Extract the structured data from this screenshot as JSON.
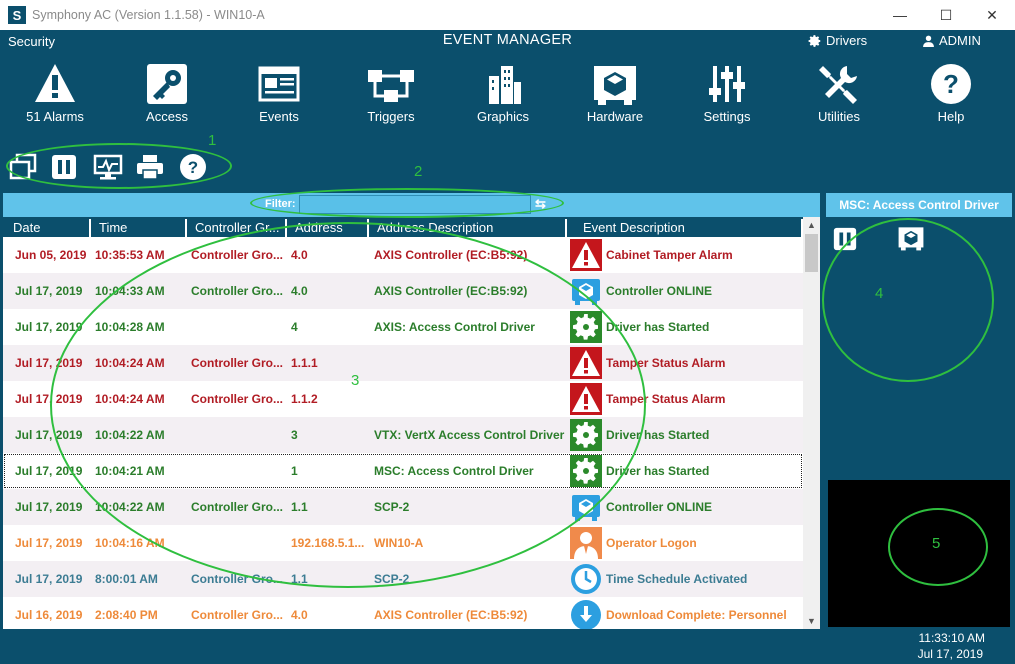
{
  "window": {
    "title": "Symphony AC  (Version 1.1.58) - WIN10-A",
    "logo_letter": "S",
    "minimize": "—",
    "maximize": "☐",
    "close": "✕"
  },
  "menubar": {
    "security": "Security",
    "title": "EVENT MANAGER",
    "drivers": "Drivers",
    "user": "ADMIN"
  },
  "toolbar": {
    "items": [
      {
        "label": "51 Alarms",
        "icon": "alarm-icon"
      },
      {
        "label": "Access",
        "icon": "access-icon"
      },
      {
        "label": "Events",
        "icon": "events-icon"
      },
      {
        "label": "Triggers",
        "icon": "triggers-icon"
      },
      {
        "label": "Graphics",
        "icon": "graphics-icon"
      },
      {
        "label": "Hardware",
        "icon": "hardware-icon"
      },
      {
        "label": "Settings",
        "icon": "settings-icon"
      },
      {
        "label": "Utilities",
        "icon": "utilities-icon"
      },
      {
        "label": "Help",
        "icon": "help-icon"
      }
    ]
  },
  "annotations": {
    "a1": "1",
    "a2": "2",
    "a3": "3",
    "a4": "4",
    "a5": "5"
  },
  "filter": {
    "label": "Filter:",
    "value": "",
    "go": "⇆"
  },
  "table": {
    "columns": [
      "Date",
      "Time",
      "Controller Gr...",
      "Address",
      "Address Description",
      "Event Description"
    ],
    "rows": [
      {
        "date": "Jun 05, 2019",
        "time": "10:35:53 AM",
        "group": "Controller Gro...",
        "address": "4.0",
        "addr_desc": "AXIS Controller (EC:B5:92)",
        "event": "Cabinet Tamper Alarm",
        "icon": "alarm-icon",
        "color": "#b11c24"
      },
      {
        "date": "Jul 17, 2019",
        "time": "10:04:33 AM",
        "group": "Controller Gro...",
        "address": "4.0",
        "addr_desc": "AXIS Controller (EC:B5:92)",
        "event": "Controller ONLINE",
        "icon": "hardware-icon",
        "color": "#2b7d2b"
      },
      {
        "date": "Jul 17, 2019",
        "time": "10:04:28 AM",
        "group": "",
        "address": "4",
        "addr_desc": "AXIS: Access Control Driver",
        "event": "Driver has Started",
        "icon": "gear-icon",
        "color": "#2b7d2b"
      },
      {
        "date": "Jul 17, 2019",
        "time": "10:04:24 AM",
        "group": "Controller Gro...",
        "address": "1.1.1",
        "addr_desc": "",
        "event": "Tamper Status Alarm",
        "icon": "alarm-icon",
        "color": "#b11c24"
      },
      {
        "date": "Jul 17, 2019",
        "time": "10:04:24 AM",
        "group": "Controller Gro...",
        "address": "1.1.2",
        "addr_desc": "",
        "event": "Tamper Status Alarm",
        "icon": "alarm-icon",
        "color": "#b11c24"
      },
      {
        "date": "Jul 17, 2019",
        "time": "10:04:22 AM",
        "group": "",
        "address": "3",
        "addr_desc": "VTX: VertX Access Control Driver",
        "event": "Driver has Started",
        "icon": "gear-icon",
        "color": "#2b7d2b"
      },
      {
        "date": "Jul 17, 2019",
        "time": "10:04:21 AM",
        "group": "",
        "address": "1",
        "addr_desc": "MSC: Access Control Driver",
        "event": "Driver has Started",
        "icon": "gear-icon",
        "color": "#2b7d2b"
      },
      {
        "date": "Jul 17, 2019",
        "time": "10:04:22 AM",
        "group": "Controller Gro...",
        "address": "1.1",
        "addr_desc": "SCP-2",
        "event": "Controller ONLINE",
        "icon": "hardware-icon",
        "color": "#2b7d2b"
      },
      {
        "date": "Jul 17, 2019",
        "time": "10:04:16 AM",
        "group": "",
        "address": "192.168.5.1...",
        "addr_desc": "WIN10-A",
        "event": "Operator Logon",
        "icon": "operator-icon",
        "color": "#ee8a3a"
      },
      {
        "date": "Jul 17, 2019",
        "time": "8:00:01 AM",
        "group": "Controller Gro...",
        "address": "1.1",
        "addr_desc": "SCP-2",
        "event": "Time Schedule Activated",
        "icon": "clock-icon",
        "color": "#3c7c93"
      },
      {
        "date": "Jul 16, 2019",
        "time": "2:08:40 PM",
        "group": "Controller Gro...",
        "address": "4.0",
        "addr_desc": "AXIS Controller (EC:B5:92)",
        "event": "Download Complete:  Personnel",
        "icon": "download-icon",
        "color": "#ee8a3a"
      }
    ]
  },
  "right_panel": {
    "title": "MSC: Access Control Driver"
  },
  "status": {
    "time": "11:33:10 AM",
    "date": "Jul 17, 2019"
  }
}
